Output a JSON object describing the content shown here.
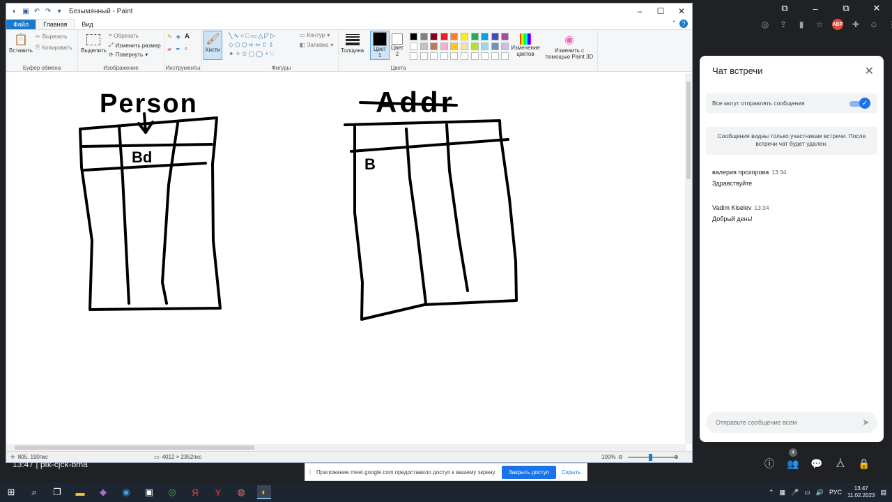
{
  "paint": {
    "title": "Безымянный - Paint",
    "tabs": {
      "file": "Файл",
      "home": "Главная",
      "view": "Вид"
    },
    "groups": {
      "clipboard": "Буфер обмена",
      "image": "Изображение",
      "tools": "Инструменты",
      "shapes": "Фигуры",
      "colors": "Цвета"
    },
    "buttons": {
      "paste": "Вставить",
      "cut": "Вырезать",
      "copy": "Копировать",
      "select": "Выделить",
      "crop": "Обрезать",
      "resize": "Изменить размер",
      "rotate": "Повернуть",
      "brushes": "Кисти",
      "outline": "Контур",
      "fill": "Заливка",
      "thickness": "Толщина",
      "color1": "Цвет 1",
      "color2": "Цвет 2",
      "edit_colors": "Изменение цветов",
      "paint3d": "Изменить с помощью Paint 3D"
    },
    "palette_row1": [
      "#000000",
      "#7f7f7f",
      "#880015",
      "#ed1c24",
      "#ff7f27",
      "#fff200",
      "#22b14c",
      "#00a2e8",
      "#3f48cc",
      "#a349a4"
    ],
    "palette_row2": [
      "#ffffff",
      "#c3c3c3",
      "#b97a57",
      "#ffaec9",
      "#ffc90e",
      "#efe4b0",
      "#b5e61d",
      "#99d9ea",
      "#7092be",
      "#c8bfe7"
    ],
    "status": {
      "cursor": "805, 190пкс",
      "size": "4012 × 2352пкс",
      "zoom": "100%"
    },
    "drawing": {
      "person": "Person",
      "addr": "Addr",
      "bd": "Bd",
      "b": "B"
    }
  },
  "chat": {
    "title": "Чат встречи",
    "toggle_label": "Все могут отправлять сообщения",
    "info": "Сообщения видны только участникам встречи. После встречи чат будет удален.",
    "messages": [
      {
        "author": "валерия прохорова",
        "time": "13:34",
        "text": "Здравствуйте"
      },
      {
        "author": "Vadim Kiselev",
        "time": "13:34",
        "text": "Добрый день!"
      }
    ],
    "input_placeholder": "Отправьте сообщение всем"
  },
  "meet": {
    "participants": "4",
    "time_label": "13:47 | ptk-cjck-bma"
  },
  "sharebar": {
    "text": "Приложение meet.google.com предоставило доступ к вашему экрану.",
    "share_button": "Закрыть доступ",
    "hide_button": "Скрыть"
  },
  "taskbar": {
    "lang": "РУС",
    "time": "13:47",
    "date": "11.02.2023"
  }
}
